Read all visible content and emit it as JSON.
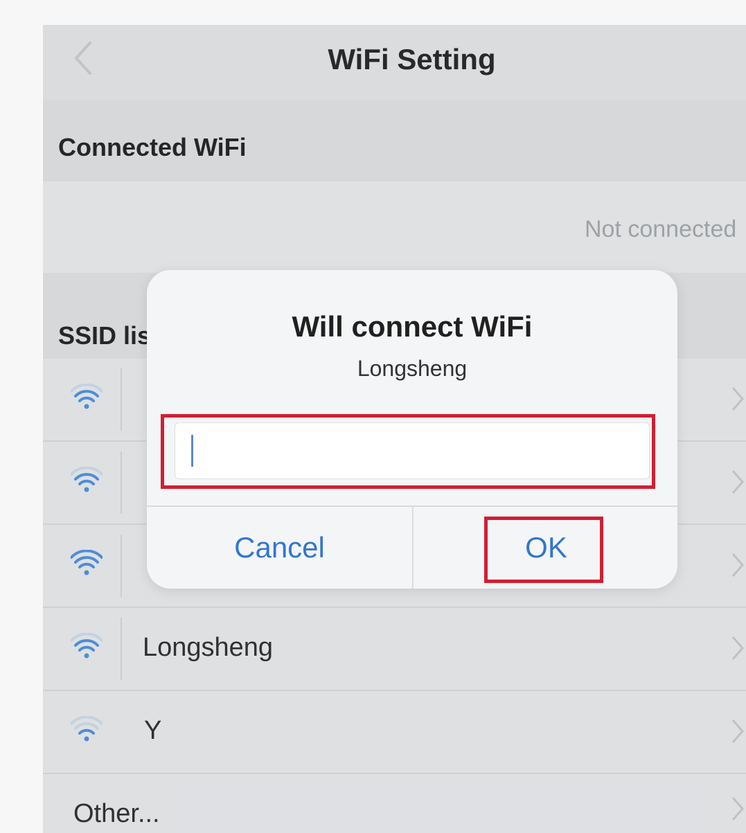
{
  "nav": {
    "title": "WiFi Setting",
    "back_icon": "chevron-left-icon"
  },
  "connected": {
    "header": "Connected WiFi",
    "status": "Not connected"
  },
  "ssid": {
    "header": "SSID list",
    "items": [
      {
        "name": "",
        "signal_bars": 2
      },
      {
        "name": "",
        "signal_bars": 2
      },
      {
        "name": "",
        "signal_bars": 3
      },
      {
        "name": "Longsheng",
        "signal_bars": 2
      },
      {
        "name": "Y",
        "signal_bars": 1
      }
    ],
    "other": "Other..."
  },
  "dialog": {
    "title": "Will connect WiFi",
    "subtitle": "Longsheng",
    "input_value": "",
    "input_placeholder": "",
    "cancel": "Cancel",
    "ok": "OK"
  },
  "colors": {
    "accent": "#3377cc",
    "wifi_icon": "#4a8fe0",
    "highlight": "#d11f33",
    "background": "#e7e8ea"
  }
}
